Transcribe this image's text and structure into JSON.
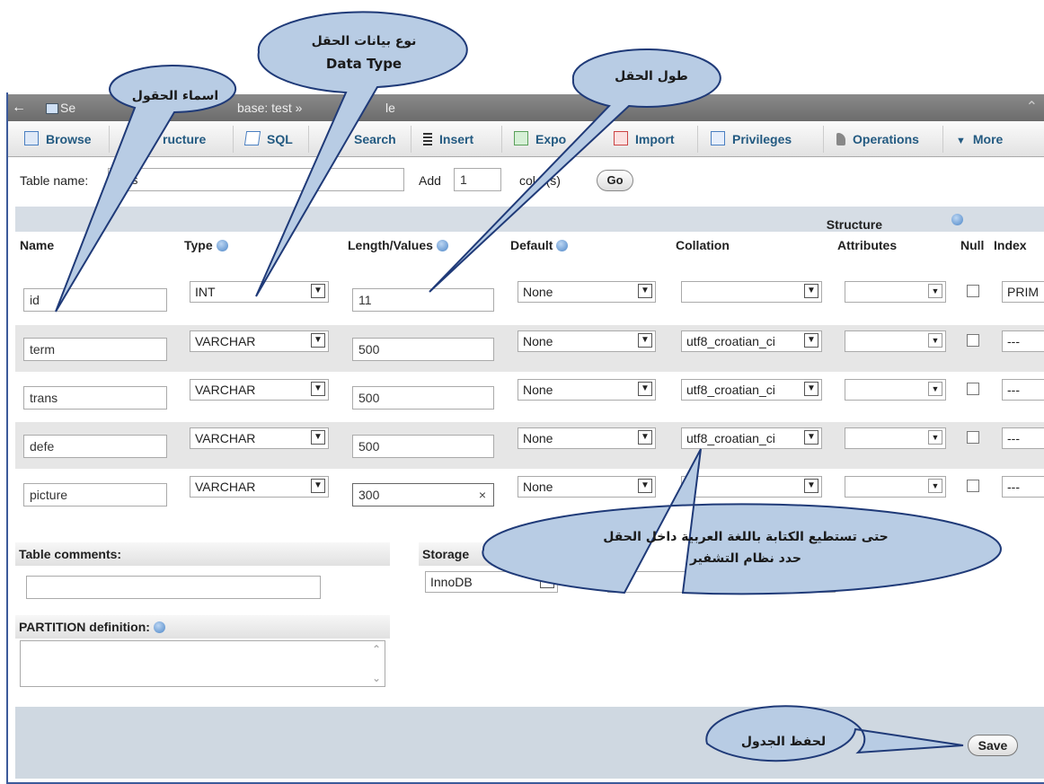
{
  "topbar": {
    "back": "←",
    "crumb1": "Se",
    "crumb2": "base: test »",
    "crumb3": "le",
    "corner": "⌃"
  },
  "tabs": [
    {
      "label": "Browse",
      "icon": "browse-icon"
    },
    {
      "label": "Structure",
      "icon": "structure-icon"
    },
    {
      "label": "SQL",
      "icon": "sql-icon"
    },
    {
      "label": "Search",
      "icon": "search-icon"
    },
    {
      "label": "Insert",
      "icon": "insert-icon"
    },
    {
      "label": "Export",
      "icon": "export-icon"
    },
    {
      "label": "Import",
      "icon": "import-icon"
    },
    {
      "label": "Privileges",
      "icon": "privileges-icon"
    },
    {
      "label": "Operations",
      "icon": "operations-icon"
    },
    {
      "label": "More",
      "icon": "caret-down-icon"
    }
  ],
  "tab_visible": {
    "structure": "ructure",
    "export": "Expo"
  },
  "form": {
    "table_name_label": "Table name:",
    "table_name_value": "t    s",
    "add_label": "Add",
    "add_value": "1",
    "columns_label": "col    n(s)",
    "go_label": "Go"
  },
  "structure_label": "Structure",
  "headers": [
    "Name",
    "Type",
    "Length/Values",
    "Default",
    "Collation",
    "Attributes",
    "Null",
    "Index"
  ],
  "rows": [
    {
      "name": "id",
      "type": "INT",
      "length": "11",
      "default": "None",
      "collation": "",
      "index": "PRIM"
    },
    {
      "name": "term",
      "type": "VARCHAR",
      "length": "500",
      "default": "None",
      "collation": "utf8_croatian_ci",
      "index": "---"
    },
    {
      "name": "trans",
      "type": "VARCHAR",
      "length": "500",
      "default": "None",
      "collation": "utf8_croatian_ci",
      "index": "---"
    },
    {
      "name": "defe",
      "type": "VARCHAR",
      "length": "500",
      "default": "None",
      "collation": "utf8_croatian_ci",
      "index": "---"
    },
    {
      "name": "picture",
      "type": "VARCHAR",
      "length": "300",
      "default": "None",
      "collation": "",
      "index": "---"
    }
  ],
  "clear_glyph": "×",
  "bottom": {
    "table_comments": "Table comments:",
    "storage_label": "Storage",
    "storage_value": "InnoDB",
    "partition_label": "PARTITION definition:",
    "save_label": "Save"
  },
  "callouts": {
    "field_names": "اسماء الحقول",
    "data_type_ar": "نوع بيانات الحقل",
    "data_type_en": "Data Type",
    "field_length": "طول الحقل",
    "collation_line1": "حتى تستطيع الكتابة باللغة العربية داخل الحقل",
    "collation_line2": "حدد نظام التشفير",
    "save_table": "لحفظ الجدول"
  },
  "colors": {
    "callout_fill": "#b8cce4",
    "callout_stroke": "#1f3a78",
    "footer": "#cfd8e1",
    "tab_text": "#235a81"
  }
}
